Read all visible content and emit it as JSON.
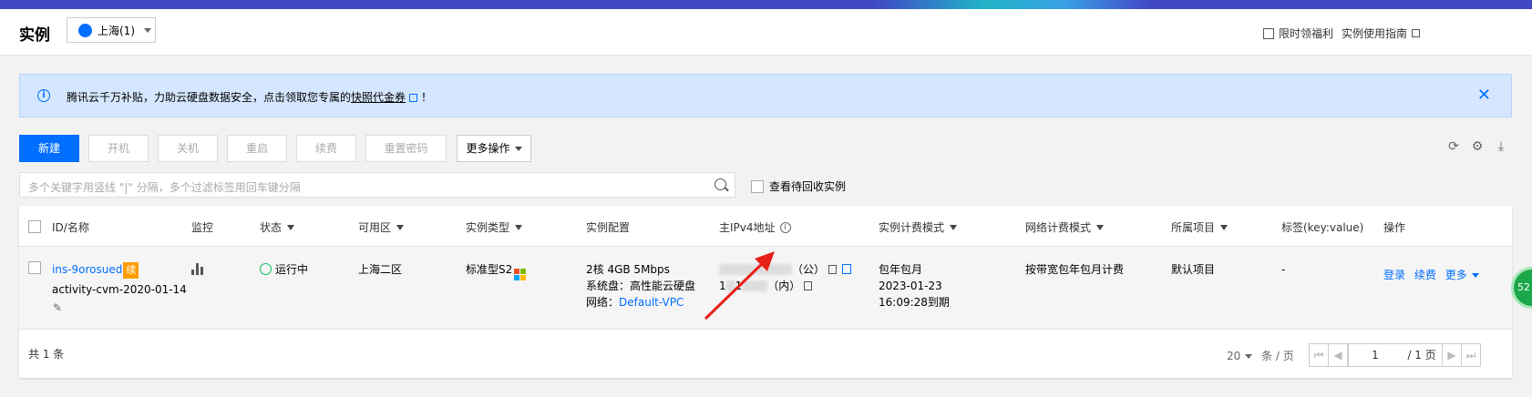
{
  "header": {
    "title": "实例",
    "region": "上海(1)",
    "links": [
      "限时领福利",
      "实例使用指南"
    ]
  },
  "banner": {
    "text": "腾讯云千万补贴，力助云硬盘数据安全，点击领取您专属的",
    "link": "快照代金券",
    "suffix": "！"
  },
  "toolbar": {
    "create": "新建",
    "start": "开机",
    "stop": "关机",
    "restart": "重启",
    "renew": "续费",
    "reset_password": "重置密码",
    "more": "更多操作"
  },
  "search": {
    "placeholder": "多个关键字用竖线 \"|\" 分隔，多个过滤标签用回车键分隔",
    "recycle_label": "查看待回收实例"
  },
  "table": {
    "columns": [
      "ID/名称",
      "监控",
      "状态",
      "可用区",
      "实例类型",
      "实例配置",
      "主IPv4地址",
      "实例计费模式",
      "网络计费模式",
      "所属项目",
      "标签(key:value)",
      "操作"
    ],
    "row": {
      "id": "ins-9orosued",
      "renew_badge": "续",
      "name": "activity-cvm-2020-01-14",
      "status": "运行中",
      "zone": "上海二区",
      "type": "标准型S2",
      "config_line1": "2核 4GB 5Mbps",
      "config_line2": "系统盘：高性能云硬盘",
      "config_line3_label": "网络：",
      "config_line3_link": "Default-VPC",
      "ip_public_suffix": "（公）",
      "ip_private_prefix": "1",
      "ip_private_mid": "1",
      "ip_private_suffix": "（内）",
      "billing_line1": "包年包月",
      "billing_line2": "2023-01-23",
      "billing_line3": "16:09:28到期",
      "net_billing": "按带宽包年包月计费",
      "project": "默认项目",
      "tags": "-",
      "action_login": "登录",
      "action_renew": "续费",
      "action_more": "更多"
    }
  },
  "footer": {
    "total": "共 1 条",
    "page_size": "20",
    "per_page_label": "条 / 页",
    "current_page": "1",
    "total_pages": "/ 1 页"
  },
  "side_bubble": "52"
}
